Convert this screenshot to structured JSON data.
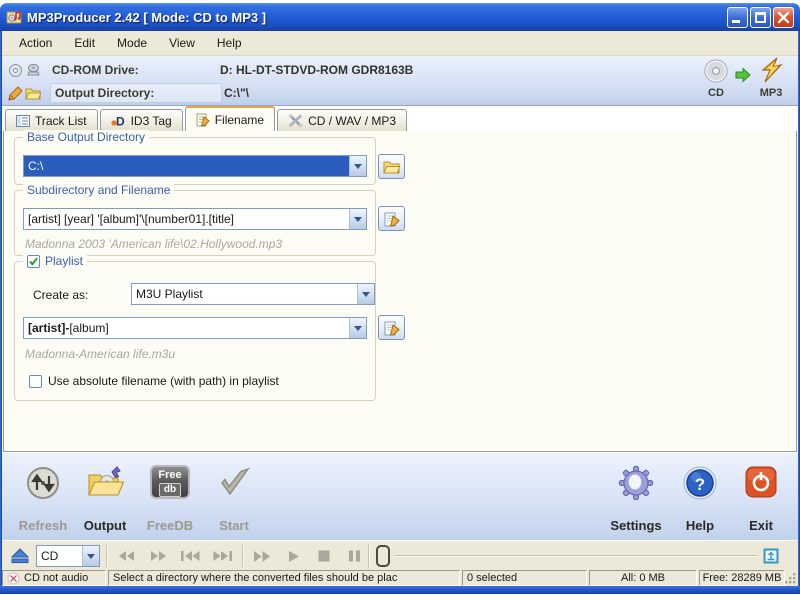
{
  "window": {
    "title": "MP3Producer 2.42 [ Mode: CD to MP3 ]"
  },
  "menu_bar": {
    "items": [
      "Action",
      "Edit",
      "Mode",
      "View",
      "Help"
    ]
  },
  "drive_bar": {
    "cdrom_label": "CD-ROM Drive:",
    "cdrom_value": "D: HL-DT-STDVD-ROM GDR8163B",
    "output_label": "Output Directory:",
    "output_value": "C:\\\"\\",
    "mode_from_label": "CD",
    "mode_to_label": "MP3"
  },
  "tabs": {
    "track_list": "Track List",
    "id3_tag": "ID3 Tag",
    "filename": "Filename",
    "cd_wav_mp3": "CD / WAV / MP3",
    "active_tab": "Filename"
  },
  "filename_page": {
    "base_group_title": "Base Output Directory",
    "base_combo_value": "C:\\",
    "subdir_group_title": "Subdirectory and Filename",
    "subdir_combo_value": "[artist] [year] '[album]'\\[number01].[title]",
    "subdir_example": "Madonna 2003 'American life\\02.Hollywood.mp3",
    "playlist_group_title": "Playlist",
    "playlist_checked": true,
    "create_as_label": "Create as:",
    "create_as_value": "M3U Playlist",
    "playlist_name_bold": "[artist]-",
    "playlist_name_rest": "[album]",
    "playlist_example": "Madonna-American life.m3u",
    "absolute_label": "Use absolute filename (with path) in playlist",
    "absolute_checked": false
  },
  "action_bar": {
    "refresh_label": "Refresh",
    "output_label": "Output",
    "freedb_label": "FreeDB",
    "freedb_icon_top": "Free",
    "freedb_icon_bottom": "db",
    "start_label": "Start",
    "settings_label": "Settings",
    "help_label": "Help",
    "exit_label": "Exit"
  },
  "player_bar": {
    "source_value": "CD"
  },
  "status_bar": {
    "cd_status": "CD not audio",
    "message": "Select a directory where the converted files should be plac",
    "selected_count": "0 selected",
    "all_size": "All: 0 MB",
    "free_space": "Free: 28289 MB"
  },
  "icons": {
    "mode_from": "cd-disc",
    "mode_arrow": "green-right-arrow",
    "mode_to": "orange-lightning",
    "refresh": "sphere-up-down-arrows",
    "output": "open-folder-with-disc",
    "start": "gray-checkmark",
    "settings": "gear",
    "help": "blue-question-sphere",
    "exit": "red-power-button",
    "status": "red-x-circle"
  },
  "colors": {
    "title_bar_blue": "#245edb",
    "selection_blue": "#2b5dbf",
    "toolbar_blue": "#d5e0f4",
    "chrome_beige": "#ece9d8",
    "panel_white": "#fdfdf6",
    "accent_orange": "#f5a623",
    "disabled_text": "#9b9a8d",
    "group_label_blue": "#3a5eae"
  }
}
